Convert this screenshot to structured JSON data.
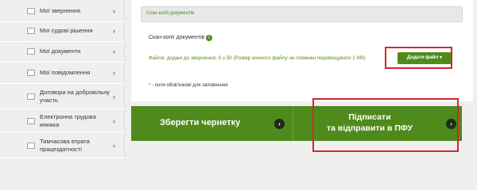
{
  "sidebar": {
    "items": [
      {
        "label": "Мої звернення",
        "icon": "envelope-icon"
      },
      {
        "label": "Мої судові рішення",
        "icon": "document-icon"
      },
      {
        "label": "Мої документи",
        "icon": "document-icon"
      },
      {
        "label": "Мої повідомлення",
        "icon": "envelope-icon"
      },
      {
        "label": "Договори на добровільну участь",
        "icon": "document-icon"
      },
      {
        "label": "Електронна трудова книжка",
        "icon": "book-icon"
      },
      {
        "label": "Тимчасова втрата працездатності",
        "icon": "document-icon"
      }
    ],
    "chevron": "›"
  },
  "form": {
    "section_title": "Скан-копії документів",
    "docs_label": "Скан-копії документів",
    "info_glyph": "i",
    "files_info": "Файли, додані до звернення, 0 з 50 (Розмір кожного файлу не повинен перевищувати 1 Мб)",
    "add_file_label": "Додати файл ▾",
    "required_star": "*",
    "required_note": " - поля обов'язкові для заповнення"
  },
  "actions": {
    "save_draft_label": "Зберегти чернетку",
    "sign_send_line1": "Підписати",
    "sign_send_line2": "та відправити в ПФУ",
    "arrow": "›"
  },
  "colors": {
    "brand_green": "#4f8a1c",
    "highlight_red": "#d6262d"
  }
}
